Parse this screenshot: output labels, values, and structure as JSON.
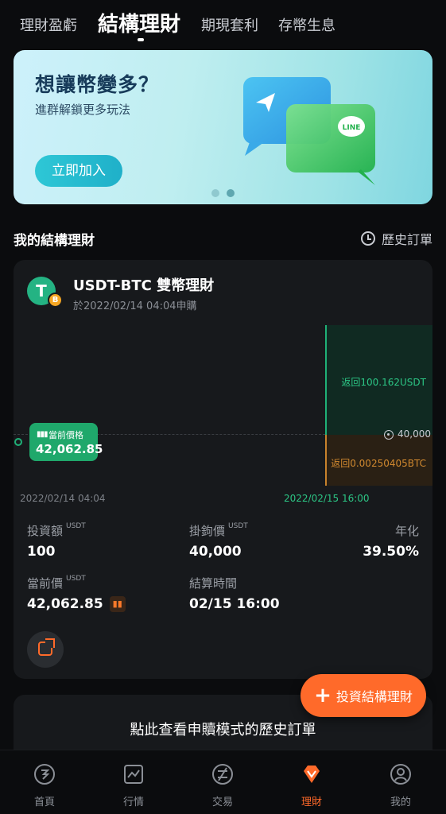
{
  "tabs": [
    {
      "label": "理財盈虧"
    },
    {
      "label": "結構理財"
    },
    {
      "label": "期現套利"
    },
    {
      "label": "存幣生息"
    }
  ],
  "banner": {
    "title": "想讓幣變多？",
    "subtitle": "進群解鎖更多玩法",
    "button": "立即加入",
    "line_badge": "LINE"
  },
  "section": {
    "title": "我的結構理財",
    "history_link": "歷史訂單"
  },
  "product": {
    "coin_symbol": "T",
    "badge_symbol": "B",
    "name": "USDT-BTC 雙幣理財",
    "subscribed_at": "於2022/02/14 04:04申購",
    "chart": {
      "current_title": "當前價格",
      "current_value": "42,062.85",
      "up_label": "返回100.162USDT",
      "down_label": "返回0.00250405BTC",
      "strike_label": "40,000",
      "start_date": "2022/02/14 04:04",
      "end_date": "2022/02/15 16:00"
    },
    "stats": {
      "invest_label": "投資額",
      "invest_unit": "USDT",
      "invest_value": "100",
      "strike_label": "掛鉤價",
      "strike_unit": "USDT",
      "strike_value": "40,000",
      "apy_label": "年化",
      "apy_value": "39.50%",
      "price_label": "當前價",
      "price_unit": "USDT",
      "price_value": "42,062.85",
      "settle_label": "結算時間",
      "settle_value": "02/15 16:00"
    }
  },
  "fab": {
    "label": "投資結構理財"
  },
  "history_card": {
    "text": "點此查看申贖模式的歷史訂單"
  },
  "nav": [
    {
      "label": "首頁"
    },
    {
      "label": "行情"
    },
    {
      "label": "交易"
    },
    {
      "label": "理財"
    },
    {
      "label": "我的"
    }
  ],
  "colors": {
    "accent": "#ff6a2a",
    "green": "#1fb077",
    "gold": "#c7822c"
  }
}
